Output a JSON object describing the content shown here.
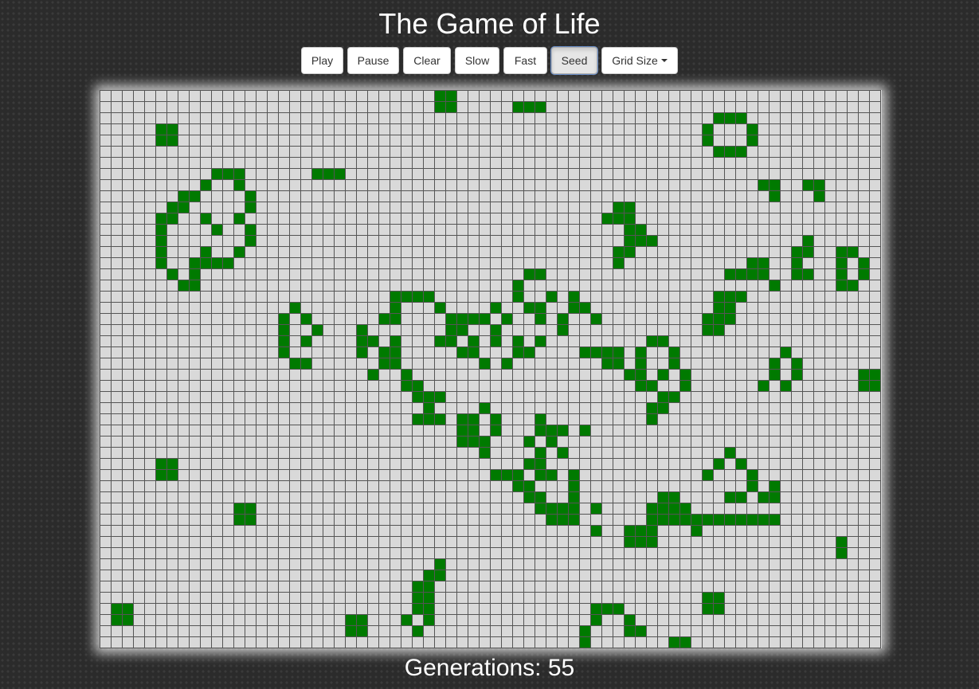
{
  "title": "The Game of Life",
  "toolbar": {
    "play": "Play",
    "pause": "Pause",
    "clear": "Clear",
    "slow": "Slow",
    "fast": "Fast",
    "seed": "Seed",
    "grid_size": "Grid Size"
  },
  "board": {
    "columns": 70,
    "rows": 50,
    "alive_color": "#007a00",
    "dead_color": "#d9d9d9",
    "live_cells": [
      [
        0,
        30
      ],
      [
        0,
        31
      ],
      [
        1,
        30
      ],
      [
        1,
        31
      ],
      [
        1,
        37
      ],
      [
        1,
        38
      ],
      [
        1,
        39
      ],
      [
        3,
        5
      ],
      [
        3,
        6
      ],
      [
        2,
        55
      ],
      [
        2,
        56
      ],
      [
        2,
        57
      ],
      [
        3,
        54
      ],
      [
        3,
        58
      ],
      [
        4,
        5
      ],
      [
        4,
        6
      ],
      [
        4,
        54
      ],
      [
        4,
        58
      ],
      [
        5,
        55
      ],
      [
        5,
        56
      ],
      [
        5,
        57
      ],
      [
        7,
        10
      ],
      [
        7,
        11
      ],
      [
        7,
        12
      ],
      [
        7,
        19
      ],
      [
        7,
        20
      ],
      [
        7,
        21
      ],
      [
        8,
        9
      ],
      [
        8,
        12
      ],
      [
        8,
        59
      ],
      [
        8,
        60
      ],
      [
        8,
        63
      ],
      [
        8,
        64
      ],
      [
        9,
        7
      ],
      [
        9,
        8
      ],
      [
        9,
        13
      ],
      [
        9,
        60
      ],
      [
        9,
        64
      ],
      [
        10,
        6
      ],
      [
        10,
        7
      ],
      [
        10,
        13
      ],
      [
        10,
        46
      ],
      [
        10,
        47
      ],
      [
        11,
        5
      ],
      [
        11,
        6
      ],
      [
        11,
        9
      ],
      [
        11,
        12
      ],
      [
        11,
        45
      ],
      [
        11,
        46
      ],
      [
        11,
        47
      ],
      [
        12,
        5
      ],
      [
        12,
        10
      ],
      [
        12,
        13
      ],
      [
        12,
        47
      ],
      [
        12,
        48
      ],
      [
        13,
        5
      ],
      [
        13,
        13
      ],
      [
        13,
        47
      ],
      [
        13,
        48
      ],
      [
        13,
        49
      ],
      [
        13,
        63
      ],
      [
        14,
        5
      ],
      [
        14,
        9
      ],
      [
        14,
        12
      ],
      [
        14,
        46
      ],
      [
        14,
        47
      ],
      [
        14,
        62
      ],
      [
        14,
        63
      ],
      [
        14,
        66
      ],
      [
        14,
        67
      ],
      [
        15,
        5
      ],
      [
        15,
        8
      ],
      [
        15,
        9
      ],
      [
        15,
        10
      ],
      [
        15,
        11
      ],
      [
        15,
        46
      ],
      [
        15,
        58
      ],
      [
        15,
        59
      ],
      [
        15,
        62
      ],
      [
        15,
        66
      ],
      [
        15,
        68
      ],
      [
        16,
        6
      ],
      [
        16,
        8
      ],
      [
        16,
        38
      ],
      [
        16,
        39
      ],
      [
        16,
        56
      ],
      [
        16,
        57
      ],
      [
        16,
        58
      ],
      [
        16,
        59
      ],
      [
        16,
        62
      ],
      [
        16,
        63
      ],
      [
        16,
        66
      ],
      [
        16,
        68
      ],
      [
        17,
        7
      ],
      [
        17,
        8
      ],
      [
        17,
        37
      ],
      [
        17,
        60
      ],
      [
        17,
        66
      ],
      [
        17,
        67
      ],
      [
        18,
        26
      ],
      [
        18,
        27
      ],
      [
        18,
        28
      ],
      [
        18,
        29
      ],
      [
        18,
        37
      ],
      [
        18,
        40
      ],
      [
        18,
        42
      ],
      [
        18,
        55
      ],
      [
        18,
        56
      ],
      [
        18,
        57
      ],
      [
        19,
        17
      ],
      [
        19,
        26
      ],
      [
        19,
        30
      ],
      [
        19,
        35
      ],
      [
        19,
        38
      ],
      [
        19,
        39
      ],
      [
        19,
        42
      ],
      [
        19,
        43
      ],
      [
        19,
        55
      ],
      [
        19,
        56
      ],
      [
        20,
        16
      ],
      [
        20,
        18
      ],
      [
        20,
        25
      ],
      [
        20,
        26
      ],
      [
        20,
        31
      ],
      [
        20,
        32
      ],
      [
        20,
        33
      ],
      [
        20,
        34
      ],
      [
        20,
        36
      ],
      [
        20,
        39
      ],
      [
        20,
        41
      ],
      [
        20,
        44
      ],
      [
        20,
        54
      ],
      [
        20,
        55
      ],
      [
        20,
        56
      ],
      [
        21,
        16
      ],
      [
        21,
        19
      ],
      [
        21,
        23
      ],
      [
        21,
        31
      ],
      [
        21,
        32
      ],
      [
        21,
        35
      ],
      [
        21,
        41
      ],
      [
        21,
        54
      ],
      [
        21,
        55
      ],
      [
        22,
        16
      ],
      [
        22,
        18
      ],
      [
        22,
        23
      ],
      [
        22,
        24
      ],
      [
        22,
        26
      ],
      [
        22,
        30
      ],
      [
        22,
        31
      ],
      [
        22,
        33
      ],
      [
        22,
        35
      ],
      [
        22,
        37
      ],
      [
        22,
        39
      ],
      [
        22,
        49
      ],
      [
        22,
        50
      ],
      [
        23,
        16
      ],
      [
        23,
        23
      ],
      [
        23,
        25
      ],
      [
        23,
        26
      ],
      [
        23,
        32
      ],
      [
        23,
        33
      ],
      [
        23,
        37
      ],
      [
        23,
        38
      ],
      [
        23,
        43
      ],
      [
        23,
        44
      ],
      [
        23,
        45
      ],
      [
        23,
        46
      ],
      [
        23,
        48
      ],
      [
        23,
        51
      ],
      [
        23,
        61
      ],
      [
        24,
        17
      ],
      [
        24,
        18
      ],
      [
        24,
        25
      ],
      [
        24,
        26
      ],
      [
        24,
        34
      ],
      [
        24,
        36
      ],
      [
        24,
        45
      ],
      [
        24,
        46
      ],
      [
        24,
        48
      ],
      [
        24,
        51
      ],
      [
        24,
        60
      ],
      [
        24,
        62
      ],
      [
        25,
        24
      ],
      [
        25,
        27
      ],
      [
        25,
        47
      ],
      [
        25,
        48
      ],
      [
        25,
        50
      ],
      [
        25,
        52
      ],
      [
        25,
        60
      ],
      [
        25,
        62
      ],
      [
        25,
        68
      ],
      [
        25,
        69
      ],
      [
        26,
        27
      ],
      [
        26,
        28
      ],
      [
        26,
        48
      ],
      [
        26,
        49
      ],
      [
        26,
        52
      ],
      [
        26,
        59
      ],
      [
        26,
        61
      ],
      [
        26,
        68
      ],
      [
        26,
        69
      ],
      [
        27,
        28
      ],
      [
        27,
        29
      ],
      [
        27,
        30
      ],
      [
        27,
        50
      ],
      [
        27,
        51
      ],
      [
        28,
        29
      ],
      [
        28,
        34
      ],
      [
        28,
        49
      ],
      [
        28,
        50
      ],
      [
        29,
        28
      ],
      [
        29,
        29
      ],
      [
        29,
        30
      ],
      [
        29,
        32
      ],
      [
        29,
        33
      ],
      [
        29,
        35
      ],
      [
        29,
        39
      ],
      [
        29,
        49
      ],
      [
        30,
        32
      ],
      [
        30,
        33
      ],
      [
        30,
        35
      ],
      [
        30,
        39
      ],
      [
        30,
        40
      ],
      [
        30,
        41
      ],
      [
        30,
        43
      ],
      [
        31,
        32
      ],
      [
        31,
        33
      ],
      [
        31,
        34
      ],
      [
        31,
        38
      ],
      [
        31,
        40
      ],
      [
        32,
        34
      ],
      [
        32,
        39
      ],
      [
        32,
        41
      ],
      [
        32,
        56
      ],
      [
        33,
        5
      ],
      [
        33,
        6
      ],
      [
        33,
        38
      ],
      [
        33,
        39
      ],
      [
        33,
        55
      ],
      [
        33,
        57
      ],
      [
        34,
        5
      ],
      [
        34,
        6
      ],
      [
        34,
        35
      ],
      [
        34,
        36
      ],
      [
        34,
        37
      ],
      [
        34,
        39
      ],
      [
        34,
        40
      ],
      [
        34,
        42
      ],
      [
        34,
        54
      ],
      [
        34,
        58
      ],
      [
        35,
        37
      ],
      [
        35,
        38
      ],
      [
        35,
        42
      ],
      [
        35,
        58
      ],
      [
        35,
        60
      ],
      [
        36,
        38
      ],
      [
        36,
        39
      ],
      [
        36,
        42
      ],
      [
        36,
        50
      ],
      [
        36,
        51
      ],
      [
        36,
        56
      ],
      [
        36,
        57
      ],
      [
        36,
        59
      ],
      [
        36,
        60
      ],
      [
        37,
        12
      ],
      [
        37,
        13
      ],
      [
        37,
        39
      ],
      [
        37,
        40
      ],
      [
        37,
        41
      ],
      [
        37,
        42
      ],
      [
        37,
        44
      ],
      [
        37,
        49
      ],
      [
        37,
        50
      ],
      [
        37,
        51
      ],
      [
        37,
        52
      ],
      [
        38,
        12
      ],
      [
        38,
        13
      ],
      [
        38,
        40
      ],
      [
        38,
        41
      ],
      [
        38,
        42
      ],
      [
        38,
        49
      ],
      [
        38,
        50
      ],
      [
        38,
        51
      ],
      [
        38,
        52
      ],
      [
        38,
        53
      ],
      [
        38,
        54
      ],
      [
        38,
        55
      ],
      [
        38,
        56
      ],
      [
        38,
        57
      ],
      [
        38,
        58
      ],
      [
        38,
        59
      ],
      [
        38,
        60
      ],
      [
        39,
        44
      ],
      [
        39,
        47
      ],
      [
        39,
        48
      ],
      [
        39,
        49
      ],
      [
        39,
        53
      ],
      [
        40,
        47
      ],
      [
        40,
        48
      ],
      [
        40,
        49
      ],
      [
        40,
        66
      ],
      [
        41,
        66
      ],
      [
        42,
        30
      ],
      [
        43,
        29
      ],
      [
        43,
        30
      ],
      [
        44,
        28
      ],
      [
        44,
        29
      ],
      [
        45,
        28
      ],
      [
        45,
        29
      ],
      [
        45,
        54
      ],
      [
        45,
        55
      ],
      [
        46,
        1
      ],
      [
        46,
        2
      ],
      [
        46,
        28
      ],
      [
        46,
        29
      ],
      [
        46,
        44
      ],
      [
        46,
        45
      ],
      [
        46,
        46
      ],
      [
        46,
        54
      ],
      [
        46,
        55
      ],
      [
        47,
        1
      ],
      [
        47,
        2
      ],
      [
        47,
        22
      ],
      [
        47,
        23
      ],
      [
        47,
        27
      ],
      [
        47,
        29
      ],
      [
        47,
        44
      ],
      [
        47,
        47
      ],
      [
        48,
        22
      ],
      [
        48,
        23
      ],
      [
        48,
        28
      ],
      [
        48,
        43
      ],
      [
        48,
        47
      ],
      [
        48,
        48
      ],
      [
        49,
        43
      ],
      [
        49,
        51
      ],
      [
        49,
        52
      ]
    ]
  },
  "status": {
    "generations_label": "Generations: 55"
  }
}
